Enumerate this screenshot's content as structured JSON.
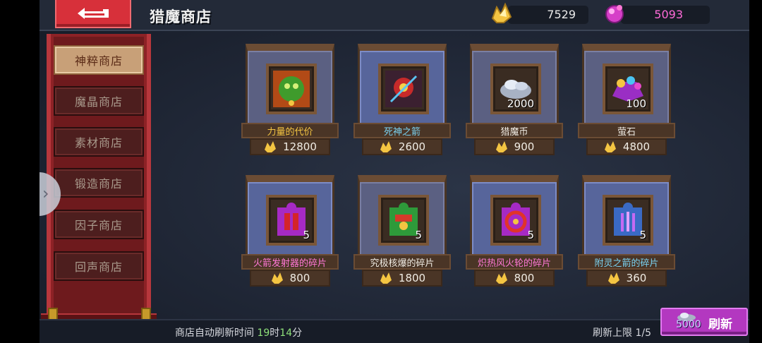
{
  "header": {
    "title": "猎魔商店",
    "gold_amount": "7529",
    "gem_amount": "5093"
  },
  "sidebar": {
    "items": [
      {
        "label": "神粹商店",
        "active": true
      },
      {
        "label": "魔晶商店",
        "active": false
      },
      {
        "label": "素材商店",
        "active": false
      },
      {
        "label": "锻造商店",
        "active": false
      },
      {
        "label": "因子商店",
        "active": false
      },
      {
        "label": "回声商店",
        "active": false
      }
    ]
  },
  "shop": {
    "items": [
      {
        "name": "力量的代价",
        "price": "12800",
        "qty": "",
        "icon": "green-lion-icon"
      },
      {
        "name": "死神之箭",
        "price": "2600",
        "qty": "",
        "icon": "reaper-arrow-icon"
      },
      {
        "name": "猎魔币",
        "price": "900",
        "qty": "2000",
        "icon": "coin-pile-icon"
      },
      {
        "name": "萤石",
        "price": "4800",
        "qty": "100",
        "icon": "gem-pile-icon"
      },
      {
        "name": "火箭发射器的碎片",
        "price": "800",
        "qty": "5",
        "icon": "puzzle-piece-icon"
      },
      {
        "name": "究极核爆的碎片",
        "price": "1800",
        "qty": "5",
        "icon": "puzzle-piece-icon"
      },
      {
        "name": "炽热风火轮的碎片",
        "price": "800",
        "qty": "5",
        "icon": "puzzle-piece-icon"
      },
      {
        "name": "附灵之箭的碎片",
        "price": "360",
        "qty": "5",
        "icon": "puzzle-piece-icon"
      }
    ]
  },
  "footer": {
    "timer_label": "商店自动刷新时间",
    "timer_hours": "19",
    "timer_h_unit": "时",
    "timer_minutes": "14",
    "timer_m_unit": "分",
    "limit_text": "刷新上限 1/5",
    "refresh_cost": "5000",
    "refresh_label": "刷新"
  },
  "colors": {
    "accent_red": "#d7303a",
    "refresh_purple": "#b338c0",
    "gold": "#f4c542",
    "gem_pink": "#ff6ad8"
  }
}
